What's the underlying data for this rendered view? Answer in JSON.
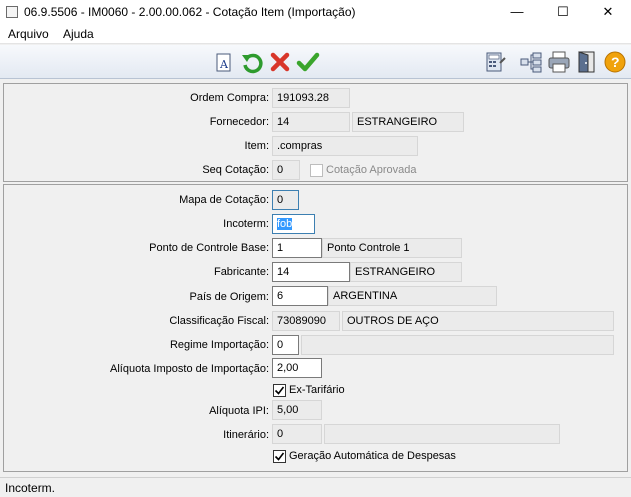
{
  "window": {
    "title": "06.9.5506 - IM0060 - 2.00.00.062 - Cotação Item (Importação)",
    "minimize": "—",
    "maximize": "☐",
    "close": "✕"
  },
  "menu": {
    "items": [
      "Arquivo",
      "Ajuda"
    ]
  },
  "toolbar": {
    "left_icons": [
      "text-document-icon",
      "undo-icon",
      "cancel-icon",
      "confirm-icon"
    ],
    "right_icons": [
      "calculator-icon",
      "tree-icon",
      "printer-icon",
      "exit-door-icon",
      "help-icon"
    ],
    "colors": {
      "undo": "#2e9b2e",
      "cancel": "#d8362a",
      "confirm": "#3aa52c",
      "help": "#f0a20c"
    }
  },
  "header": {
    "ordem_compra": {
      "label": "Ordem Compra:",
      "value": "191093.28"
    },
    "fornecedor": {
      "label": "Fornecedor:",
      "code": "14",
      "name": "ESTRANGEIRO"
    },
    "item": {
      "label": "Item:",
      "value": ".compras"
    },
    "seq_cotacao": {
      "label": "Seq Cotação:",
      "value": "0",
      "aprovada_label": "Cotação Aprovada",
      "aprovada_checked": false
    }
  },
  "detail": {
    "mapa_cotacao": {
      "label": "Mapa de Cotação:",
      "value": "0"
    },
    "incoterm": {
      "label": "Incoterm:",
      "value": "fob"
    },
    "ponto_controle": {
      "label": "Ponto de Controle Base:",
      "code": "1",
      "desc": "Ponto Controle 1"
    },
    "fabricante": {
      "label": "Fabricante:",
      "code": "14",
      "name": "ESTRANGEIRO"
    },
    "pais_origem": {
      "label": "País de Origem:",
      "code": "6",
      "name": "ARGENTINA"
    },
    "classificacao_fiscal": {
      "label": "Classificação Fiscal:",
      "code": "73089090",
      "desc": "OUTROS DE AÇO"
    },
    "regime_importacao": {
      "label": "Regime Importação:",
      "code": "0",
      "desc": ""
    },
    "aliquota_importacao": {
      "label": "Alíquota Imposto de Importação:",
      "value": "2,00"
    },
    "ex_tarifario": {
      "label": "Ex-Tarifário",
      "checked": true
    },
    "aliquota_ipi": {
      "label": "Alíquota IPI:",
      "value": "5,00"
    },
    "itinerario": {
      "label": "Itinerário:",
      "code": "0",
      "desc": ""
    },
    "geracao_despesas": {
      "label": "Geração Automática de Despesas",
      "checked": true
    }
  },
  "status": {
    "text": "Incoterm."
  }
}
